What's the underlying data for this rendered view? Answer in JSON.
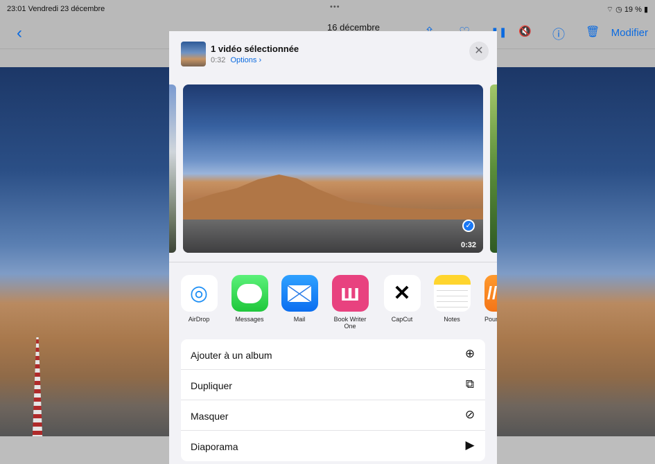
{
  "status_bar": {
    "time_date": "23:01  Vendredi 23 décembre",
    "multitask": "•••",
    "indicators": "⌔ ◷ 19 % ▮"
  },
  "photos_nav": {
    "back": "‹",
    "title": "16 décembre",
    "share_icon": "⇧",
    "heart_icon": "♡",
    "pause_icon": "❚❚",
    "mute_icon": "🔇",
    "info_icon": "ⓘ",
    "trash_icon": "🗑",
    "edit_label": "Modifier"
  },
  "share_sheet": {
    "title": "1 vidéo sélectionnée",
    "duration": "0:32",
    "options_label": "Options ›",
    "close": "✕",
    "preview": {
      "duration": "0:32",
      "check": "✓"
    },
    "apps": [
      {
        "label": "AirDrop",
        "glyph": "◎"
      },
      {
        "label": "Messages",
        "glyph": ""
      },
      {
        "label": "Mail",
        "glyph": ""
      },
      {
        "label": "Book Writer One",
        "glyph": "ш"
      },
      {
        "label": "CapCut",
        "glyph": "✕"
      },
      {
        "label": "Notes",
        "glyph": ""
      },
      {
        "label": "Pour",
        "glyph": "//"
      }
    ],
    "actions": [
      {
        "label": "Ajouter à un album",
        "icon": "⊕"
      },
      {
        "label": "Dupliquer",
        "icon": "⧉"
      },
      {
        "label": "Masquer",
        "icon": "⊘"
      },
      {
        "label": "Diaporama",
        "icon": "▶"
      }
    ]
  }
}
